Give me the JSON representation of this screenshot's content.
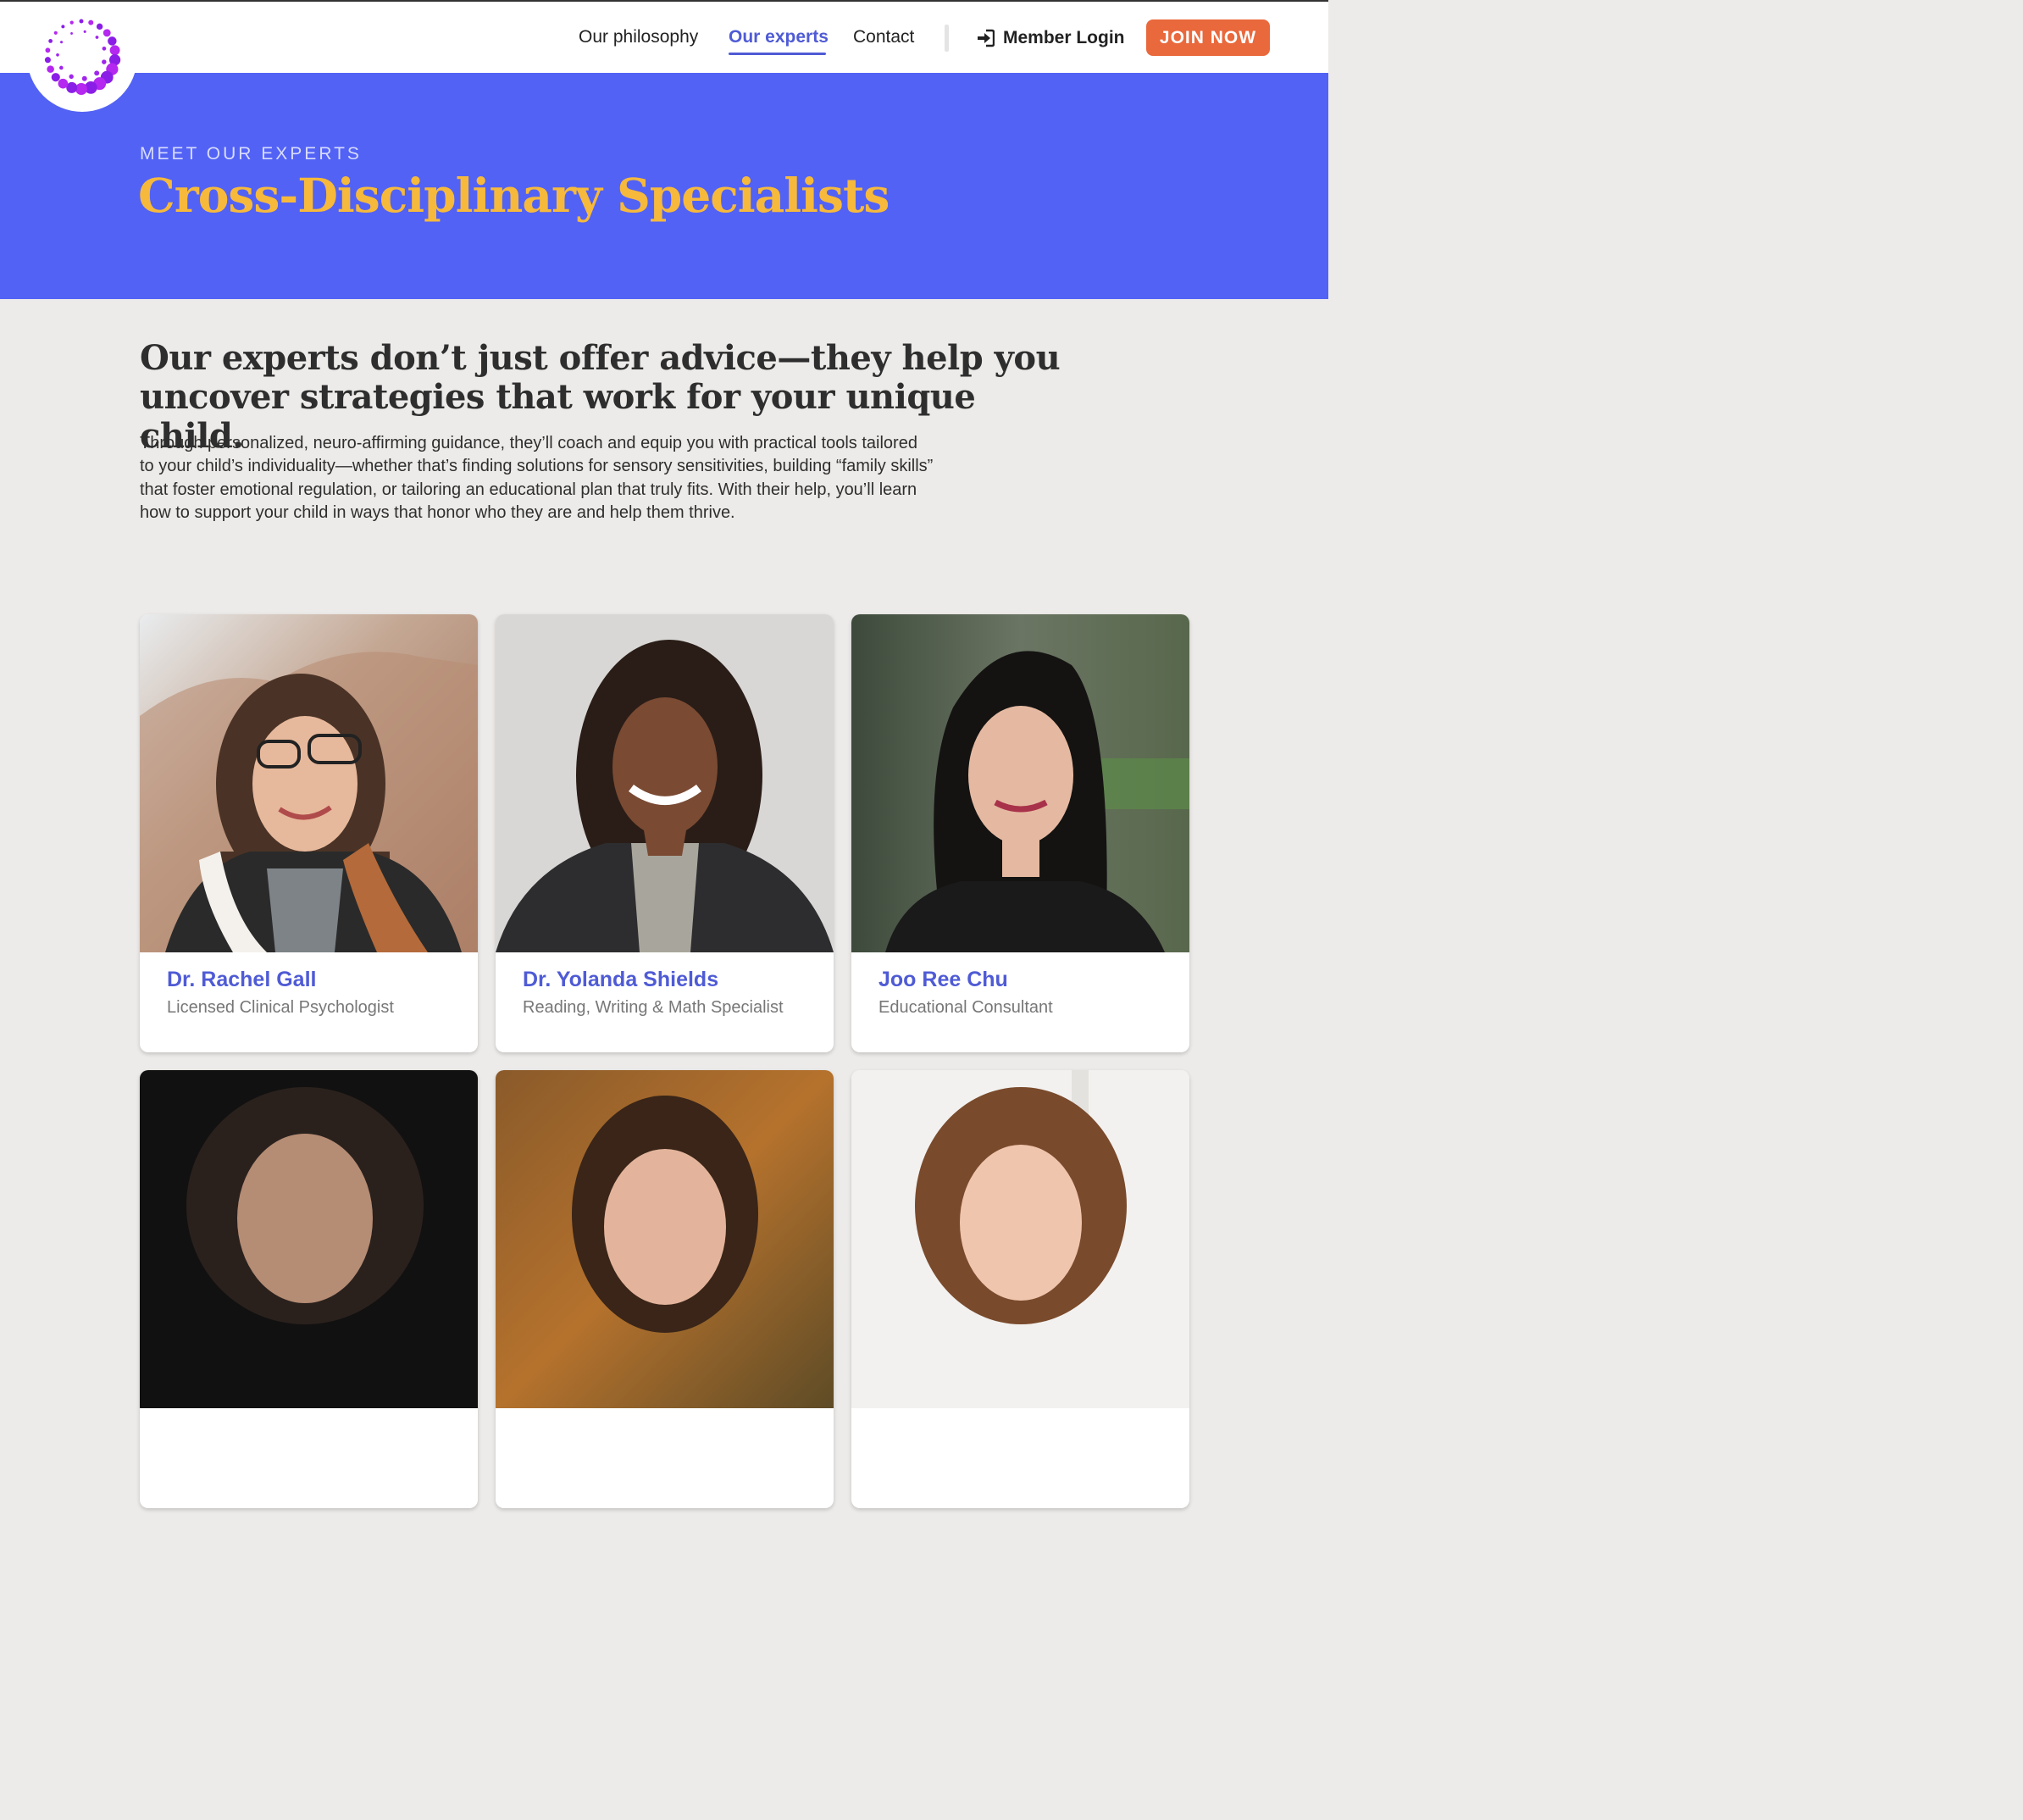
{
  "brand": {
    "accent": "#4f5bd5",
    "hero_bg": "#5262f5",
    "title_color": "#f6b93b",
    "join_bg": "#e9683c",
    "logo_color": "#9b1fe8"
  },
  "nav": {
    "links": [
      {
        "label": "Our philosophy",
        "active": false
      },
      {
        "label": "Our experts",
        "active": true
      },
      {
        "label": "Contact",
        "active": false
      }
    ],
    "login_label": "Member Login",
    "login_icon": "sign-in-icon",
    "join_label": "JOIN NOW"
  },
  "hero": {
    "eyebrow": "MEET OUR EXPERTS",
    "title": "Cross-Disciplinary Specialists"
  },
  "intro": {
    "heading": "Our experts don’t just offer advice—they help you uncover strategies that work for your unique child.",
    "body": "Through personalized, neuro-affirming guidance, they’ll coach and equip you with practical tools tailored to your child’s individuality—whether that’s finding solutions for sensory sensitivities, building “family skills” that foster emotional regulation, or tailoring an educational plan that truly fits. With their help, you’ll learn how to support your child in ways that honor who they are and help them thrive."
  },
  "experts": [
    {
      "name": "Dr. Rachel Gall",
      "role": "Licensed Clinical Psychologist"
    },
    {
      "name": "Dr. Yolanda Shields",
      "role": "Reading, Writing & Math Specialist"
    },
    {
      "name": "Joo Ree Chu",
      "role": "Educational Consultant"
    },
    {
      "name": "",
      "role": ""
    },
    {
      "name": "",
      "role": ""
    },
    {
      "name": "",
      "role": ""
    }
  ]
}
